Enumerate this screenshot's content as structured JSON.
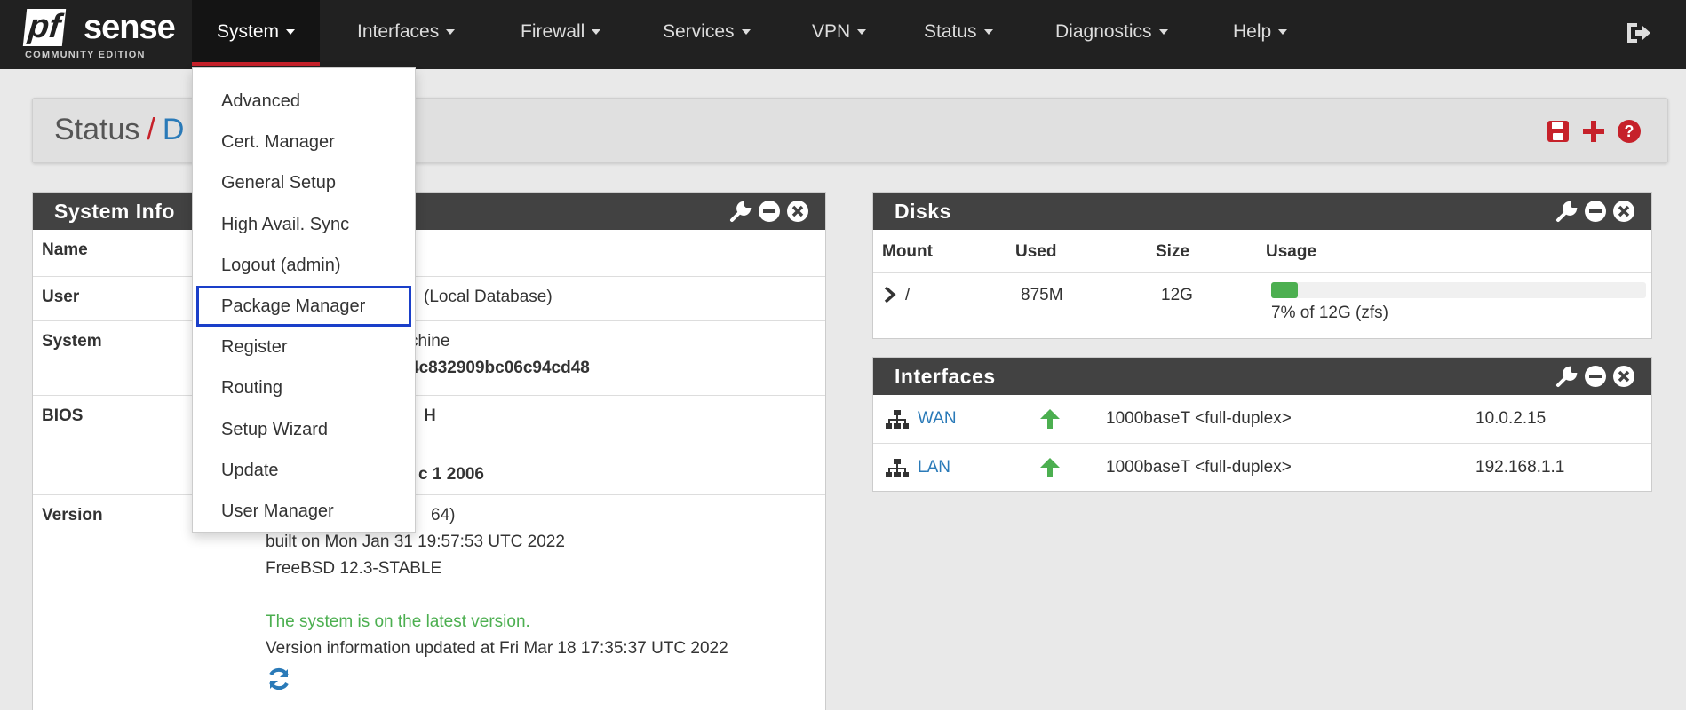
{
  "nav": {
    "logo_main": "pf",
    "logo_sense": "sense",
    "logo_edition": "COMMUNITY EDITION",
    "items": [
      "System",
      "Interfaces",
      "Firewall",
      "Services",
      "VPN",
      "Status",
      "Diagnostics",
      "Help"
    ]
  },
  "system_menu": {
    "items": [
      "Advanced",
      "Cert. Manager",
      "General Setup",
      "High Avail. Sync",
      "Logout (admin)",
      "Package Manager",
      "Register",
      "Routing",
      "Setup Wizard",
      "Update",
      "User Manager"
    ]
  },
  "breadcrumb": {
    "section": "Status",
    "sep": "/",
    "current": "D"
  },
  "sysinfo": {
    "title": "System Info",
    "rows": {
      "name": "Name",
      "user": "User",
      "user_value": "(Local Database)",
      "system": "System",
      "system_value1": "chine",
      "system_value2": "4c832909bc06c94cd48",
      "bios": "BIOS",
      "bios_value1": "H",
      "bios_value2": "c 1 2006",
      "version": "Version",
      "version_value1": "64)",
      "version_value2": "built on Mon Jan 31 19:57:53 UTC 2022",
      "version_value3": "FreeBSD 12.3-STABLE",
      "version_latest": "The system is on the latest version.",
      "version_updated": "Version information updated at Fri Mar 18 17:35:37 UTC 2022"
    }
  },
  "disks": {
    "title": "Disks",
    "headers": [
      "Mount",
      "Used",
      "Size",
      "Usage"
    ],
    "row": {
      "mount": "/",
      "used": "875M",
      "size": "12G",
      "usage_text": "7% of 12G (zfs)",
      "usage_fraction": 0.07
    }
  },
  "interfaces": {
    "title": "Interfaces",
    "rows": [
      {
        "name": "WAN",
        "media": "1000baseT <full-duplex>",
        "ip": "10.0.2.15"
      },
      {
        "name": "LAN",
        "media": "1000baseT <full-duplex>",
        "ip": "192.168.1.1"
      }
    ]
  },
  "colors": {
    "accent_red": "#c6212a",
    "link_blue": "#2a7ab8",
    "status_green": "#4caf50",
    "highlight_blue": "#1a3fc9"
  },
  "icons": [
    "logout-icon",
    "save-icon",
    "plus-icon",
    "help-icon",
    "wrench-icon",
    "minus-circle-icon",
    "close-circle-icon",
    "chevron-right-icon",
    "network-icon",
    "arrow-up-icon",
    "refresh-icon"
  ]
}
